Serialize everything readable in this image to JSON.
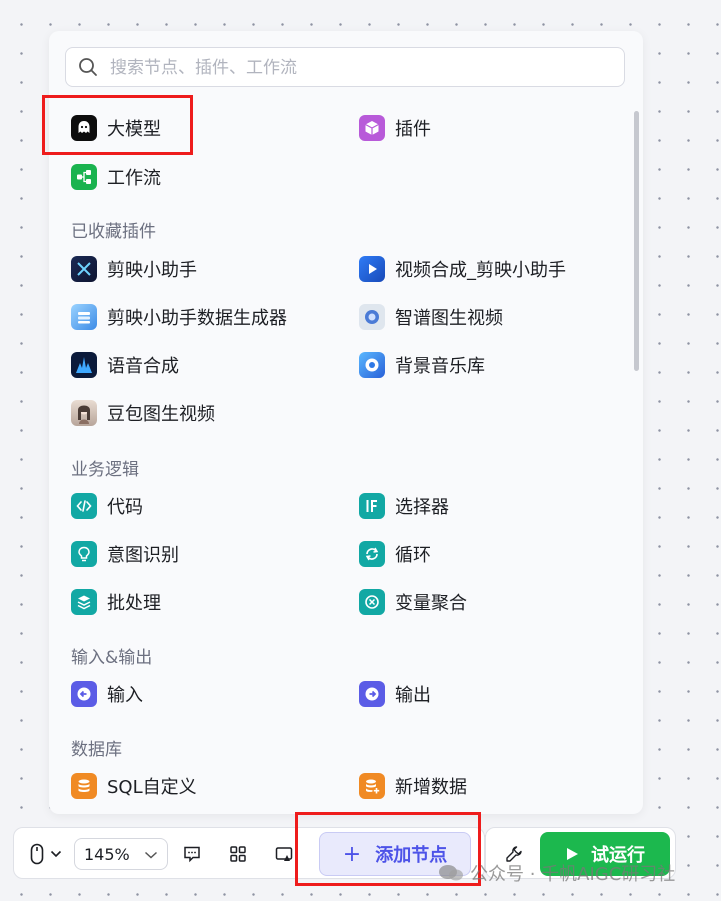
{
  "search": {
    "placeholder": "搜索节点、插件、工作流"
  },
  "top_items": [
    {
      "label": "大模型",
      "icon": "llm-ghost-icon",
      "color": "#0d0d0d"
    },
    {
      "label": "插件",
      "icon": "plugin-cube-icon",
      "color": "#b85ad9"
    },
    {
      "label": "工作流",
      "icon": "workflow-icon",
      "color": "#1ab34f"
    }
  ],
  "sections": {
    "favorites": {
      "title": "已收藏插件",
      "items": [
        {
          "label": "剪映小助手",
          "icon": "jianying-icon"
        },
        {
          "label": "视频合成_剪映小助手",
          "icon": "video-compose-icon"
        },
        {
          "label": "剪映小助手数据生成器",
          "icon": "data-generator-icon"
        },
        {
          "label": "智谱图生视频",
          "icon": "zhipu-icon"
        },
        {
          "label": "语音合成",
          "icon": "speech-synthesis-icon"
        },
        {
          "label": "背景音乐库",
          "icon": "music-library-icon"
        },
        {
          "label": "豆包图生视频",
          "icon": "doubao-avatar-icon"
        }
      ]
    },
    "logic": {
      "title": "业务逻辑",
      "items": [
        {
          "label": "代码",
          "icon": "code-icon"
        },
        {
          "label": "选择器",
          "icon": "if-selector-icon"
        },
        {
          "label": "意图识别",
          "icon": "intent-bulb-icon"
        },
        {
          "label": "循环",
          "icon": "loop-icon"
        },
        {
          "label": "批处理",
          "icon": "batch-layers-icon"
        },
        {
          "label": "变量聚合",
          "icon": "variable-merge-icon"
        }
      ]
    },
    "io": {
      "title": "输入&输出",
      "items": [
        {
          "label": "输入",
          "icon": "input-icon"
        },
        {
          "label": "输出",
          "icon": "output-icon"
        }
      ]
    },
    "database": {
      "title": "数据库",
      "items": [
        {
          "label": "SQL自定义",
          "icon": "sql-database-icon"
        },
        {
          "label": "新增数据",
          "icon": "add-data-icon"
        }
      ]
    }
  },
  "toolbar": {
    "zoom": "145%",
    "add_node_label": "添加节点",
    "run_label": "试运行"
  },
  "watermark": "公众号 · 千帆AIGC研习社",
  "colors": {
    "accent": "#4d53e8",
    "run_green": "#1cb84e",
    "logic_teal": "#12a8a4",
    "io_indigo": "#5b5ce6",
    "db_orange": "#f08a24",
    "highlight_red": "#ee1c1c"
  }
}
